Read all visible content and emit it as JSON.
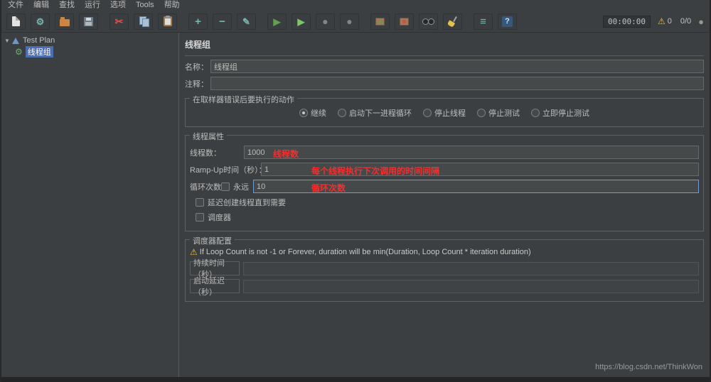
{
  "menu": {
    "items": [
      "文件",
      "编辑",
      "查找",
      "运行",
      "选项",
      "Tools",
      "帮助"
    ]
  },
  "toolbar": {
    "buttons": [
      {
        "name": "new-file"
      },
      {
        "name": "templates",
        "glyph": "⚙"
      },
      {
        "name": "open-file"
      },
      {
        "name": "save"
      },
      {
        "name": "cut",
        "glyph": "✂"
      },
      {
        "name": "copy"
      },
      {
        "name": "paste"
      },
      {
        "name": "add",
        "glyph": "+"
      },
      {
        "name": "remove",
        "glyph": "−"
      },
      {
        "name": "toggle",
        "glyph": "✎"
      },
      {
        "name": "start",
        "glyph": "▶"
      },
      {
        "name": "start-no-pauses",
        "glyph": "▶"
      },
      {
        "name": "stop",
        "glyph": "●"
      },
      {
        "name": "shutdown",
        "glyph": "●"
      },
      {
        "name": "remote-start-all"
      },
      {
        "name": "remote-shutdown-all"
      },
      {
        "name": "search"
      },
      {
        "name": "clear-all"
      },
      {
        "name": "function-helper",
        "glyph": "≡"
      },
      {
        "name": "help",
        "glyph": "?"
      }
    ],
    "timer": "00:00:00",
    "warning_count": "0",
    "thread_counter": "0/0"
  },
  "icons": {
    "expander": "▼",
    "thread_group": "⚙",
    "warning": "⚠",
    "status_circle": "●"
  },
  "tree": {
    "items": [
      {
        "label": "Test Plan",
        "selected": false
      },
      {
        "label": "线程组",
        "selected": true
      }
    ]
  },
  "panel": {
    "title": "线程组",
    "name_label": "名称：",
    "name_value": "线程组",
    "comment_label": "注释：",
    "comment_value": "",
    "action_group": {
      "title": "在取样器错误后要执行的动作",
      "options": [
        {
          "label": "继续",
          "selected": true
        },
        {
          "label": "启动下一进程循环",
          "selected": false
        },
        {
          "label": "停止线程",
          "selected": false
        },
        {
          "label": "停止测试",
          "selected": false
        },
        {
          "label": "立即停止测试",
          "selected": false
        }
      ]
    },
    "thread_props": {
      "title": "线程属性",
      "threads_label": "线程数：",
      "threads_value": "1000",
      "threads_annotation": "线程数",
      "rampup_label": "Ramp-Up时间（秒）：",
      "rampup_value": "1",
      "rampup_annotation": "每个线程执行下次调用的时间间隔",
      "loop_label": "循环次数",
      "forever_label": "永远",
      "forever_checked": false,
      "loop_value": "10",
      "loop_annotation": "循环次数",
      "delay_create_label": "延迟创建线程直到需要",
      "delay_create_checked": false,
      "scheduler_label": "调度器",
      "scheduler_checked": false
    },
    "scheduler": {
      "title": "调度器配置",
      "warning_text": "If Loop Count is not -1 or Forever, duration will be min(Duration, Loop Count * iteration duration)",
      "duration_label": "持续时间（秒）",
      "duration_value": "",
      "startup_delay_label": "启动延迟（秒）",
      "startup_delay_value": ""
    }
  },
  "colors": {
    "selection": "#4b6eaf",
    "annotation_red": "#fb2c2c",
    "warning_yellow": "#e8bf4c",
    "start_green": "#61a14f"
  },
  "watermark": "https://blog.csdn.net/ThinkWon"
}
